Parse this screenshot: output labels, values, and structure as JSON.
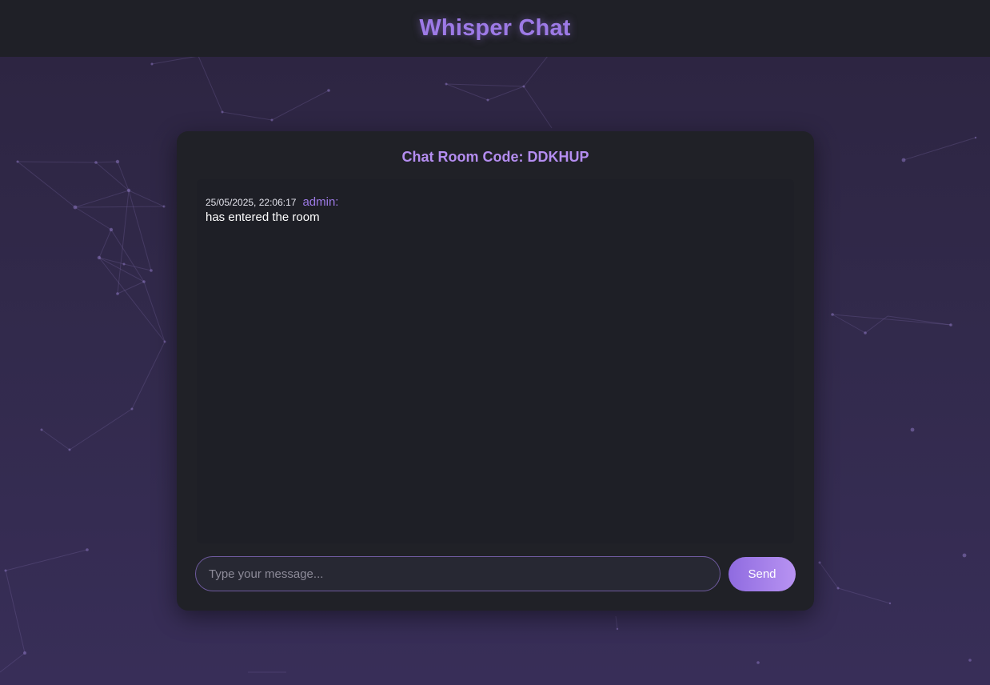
{
  "app": {
    "title": "Whisper Chat"
  },
  "room": {
    "heading_label": "Chat Room Code:",
    "code": "DDKHUP"
  },
  "messages": [
    {
      "timestamp": "25/05/2025, 22:06:17",
      "user": "admin:",
      "text": "has entered the room"
    }
  ],
  "composer": {
    "placeholder": "Type your message...",
    "value": "",
    "send_label": "Send"
  },
  "colors": {
    "accent": "#9d7ae6",
    "header_bg": "#1f2027",
    "card_bg": "#202127",
    "background": "#322a4c"
  }
}
